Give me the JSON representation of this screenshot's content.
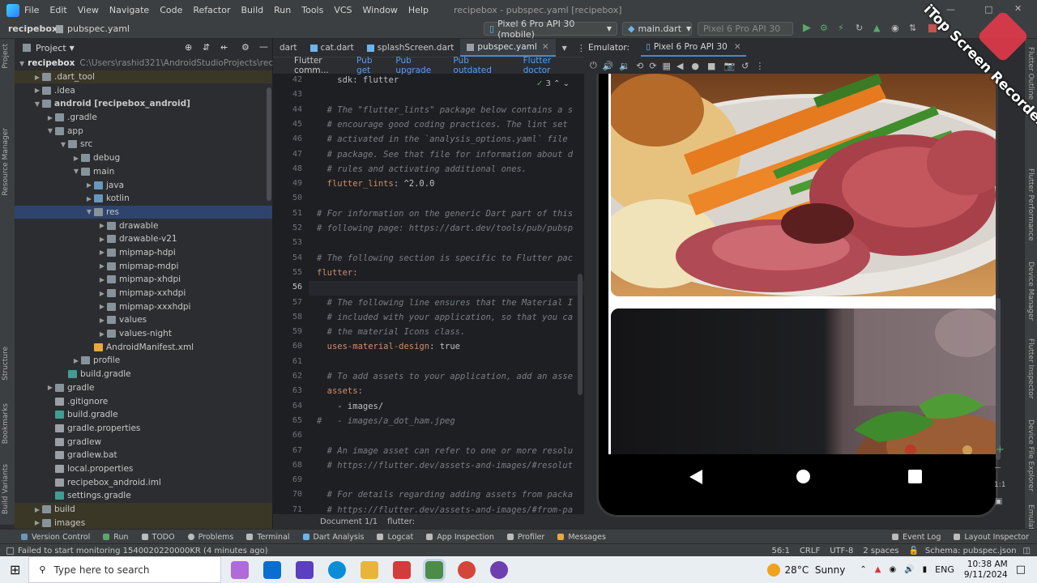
{
  "menubar": {
    "items": [
      "File",
      "Edit",
      "View",
      "Navigate",
      "Code",
      "Refactor",
      "Build",
      "Run",
      "Tools",
      "VCS",
      "Window",
      "Help"
    ],
    "title": "recipebox - pubspec.yaml [recipebox]"
  },
  "toolbar": {
    "breadcrumb_project": "recipebox",
    "breadcrumb_file": "pubspec.yaml",
    "device_select": "Pixel 6 Pro API 30 (mobile)",
    "run_config": "main.dart",
    "device_running": "Pixel 6 Pro API 30"
  },
  "left_strip": [
    "Project",
    "Resource Manager",
    "Structure",
    "Bookmarks",
    "Build Variants"
  ],
  "project": {
    "header": "Project",
    "root_label": "recipebox",
    "root_path": "C:\\Users\\rashid321\\AndroidStudioProjects\\recipebox",
    "rows": [
      {
        "label": ".dart_tool",
        "depth": 1
      },
      {
        "label": ".idea",
        "depth": 1
      },
      {
        "label": "android [recipebox_android]",
        "depth": 1
      },
      {
        "label": ".gradle",
        "depth": 2
      },
      {
        "label": "app",
        "depth": 2
      },
      {
        "label": "src",
        "depth": 3
      },
      {
        "label": "debug",
        "depth": 4
      },
      {
        "label": "main",
        "depth": 4
      },
      {
        "label": "java",
        "depth": 5
      },
      {
        "label": "kotlin",
        "depth": 5
      },
      {
        "label": "res",
        "depth": 5
      },
      {
        "label": "drawable",
        "depth": 6
      },
      {
        "label": "drawable-v21",
        "depth": 6
      },
      {
        "label": "mipmap-hdpi",
        "depth": 6
      },
      {
        "label": "mipmap-mdpi",
        "depth": 6
      },
      {
        "label": "mipmap-xhdpi",
        "depth": 6
      },
      {
        "label": "mipmap-xxhdpi",
        "depth": 6
      },
      {
        "label": "mipmap-xxxhdpi",
        "depth": 6
      },
      {
        "label": "values",
        "depth": 6
      },
      {
        "label": "values-night",
        "depth": 6
      },
      {
        "label": "AndroidManifest.xml",
        "depth": 5
      },
      {
        "label": "profile",
        "depth": 4
      },
      {
        "label": "build.gradle",
        "depth": 3
      },
      {
        "label": "gradle",
        "depth": 2
      },
      {
        "label": ".gitignore",
        "depth": 2
      },
      {
        "label": "build.gradle",
        "depth": 2
      },
      {
        "label": "gradle.properties",
        "depth": 2
      },
      {
        "label": "gradlew",
        "depth": 2
      },
      {
        "label": "gradlew.bat",
        "depth": 2
      },
      {
        "label": "local.properties",
        "depth": 2
      },
      {
        "label": "recipebox_android.iml",
        "depth": 2
      },
      {
        "label": "settings.gradle",
        "depth": 2
      },
      {
        "label": "build",
        "depth": 1
      },
      {
        "label": "images",
        "depth": 1
      }
    ]
  },
  "editor": {
    "tabs": [
      "dart",
      "cat.dart",
      "splashScreen.dart",
      "pubspec.yaml"
    ],
    "flutter_bar": {
      "label": "Flutter comm...",
      "links": [
        "Pub get",
        "Pub upgrade",
        "Pub outdated",
        "Flutter doctor"
      ]
    },
    "inspection_count": "3",
    "lines": [
      {
        "n": "42",
        "text": "    sdk: flutter",
        "kind": "val"
      },
      {
        "n": "43",
        "text": "",
        "kind": "val"
      },
      {
        "n": "44",
        "text": "  # The \"flutter_lints\" package below contains a s",
        "kind": "cmt"
      },
      {
        "n": "45",
        "text": "  # encourage good coding practices. The lint set",
        "kind": "cmt"
      },
      {
        "n": "46",
        "text": "  # activated in the `analysis_options.yaml` file",
        "kind": "cmt"
      },
      {
        "n": "47",
        "text": "  # package. See that file for information about d",
        "kind": "cmt"
      },
      {
        "n": "48",
        "text": "  # rules and activating additional ones.",
        "kind": "cmt"
      },
      {
        "n": "49",
        "text": "  flutter_lints: ^2.0.0",
        "kind": "kv"
      },
      {
        "n": "50",
        "text": "",
        "kind": "val"
      },
      {
        "n": "51",
        "text": "# For information on the generic Dart part of this",
        "kind": "cmt"
      },
      {
        "n": "52",
        "text": "# following page: https://dart.dev/tools/pub/pubsp",
        "kind": "cmt"
      },
      {
        "n": "53",
        "text": "",
        "kind": "val"
      },
      {
        "n": "54",
        "text": "# The following section is specific to Flutter pac",
        "kind": "cmt"
      },
      {
        "n": "55",
        "text": "flutter:",
        "kind": "key"
      },
      {
        "n": "56",
        "text": "",
        "kind": "val"
      },
      {
        "n": "57",
        "text": "  # The following line ensures that the Material I",
        "kind": "cmt"
      },
      {
        "n": "58",
        "text": "  # included with your application, so that you ca",
        "kind": "cmt"
      },
      {
        "n": "59",
        "text": "  # the material Icons class.",
        "kind": "cmt"
      },
      {
        "n": "60",
        "text": "  uses-material-design: true",
        "kind": "kv"
      },
      {
        "n": "61",
        "text": "",
        "kind": "val"
      },
      {
        "n": "62",
        "text": "  # To add assets to your application, add an asse",
        "kind": "cmt"
      },
      {
        "n": "63",
        "text": "  assets:",
        "kind": "key"
      },
      {
        "n": "64",
        "text": "    - images/",
        "kind": "val"
      },
      {
        "n": "65",
        "text": "#   - images/a_dot_ham.jpeg",
        "kind": "cmt"
      },
      {
        "n": "66",
        "text": "",
        "kind": "val"
      },
      {
        "n": "67",
        "text": "  # An image asset can refer to one or more resolu",
        "kind": "cmt"
      },
      {
        "n": "68",
        "text": "  # https://flutter.dev/assets-and-images/#resolut",
        "kind": "cmt"
      },
      {
        "n": "69",
        "text": "",
        "kind": "val"
      },
      {
        "n": "70",
        "text": "  # For details regarding adding assets from packa",
        "kind": "cmt"
      },
      {
        "n": "71",
        "text": "  # https://flutter.dev/assets-and-images/#from-pa",
        "kind": "cmt"
      }
    ],
    "status_doc": "Document 1/1",
    "status_path": "flutter:"
  },
  "emulator": {
    "label": "Emulator:",
    "device_tab": "Pixel 6 Pro API 30",
    "zoom": "1:1"
  },
  "right_strip": [
    "Flutter Outline",
    "Flutter Performance",
    "Device Manager",
    "Flutter Inspector",
    "Device File Explorer",
    "Emulator"
  ],
  "bottom_tools": [
    "Version Control",
    "Run",
    "TODO",
    "Problems",
    "Terminal",
    "Dart Analysis",
    "Logcat",
    "App Inspection",
    "Profiler",
    "Messages",
    "Event Log",
    "Layout Inspector"
  ],
  "status": {
    "message": "Failed to start monitoring 1540020220000KR (4 minutes ago)",
    "position": "56:1",
    "line_sep": "CRLF",
    "encoding": "UTF-8",
    "indent": "2 spaces",
    "schema": "Schema: pubspec.json"
  },
  "taskbar": {
    "search_placeholder": "Type here to search",
    "weather": "28°C  Sunny",
    "lang": "ENG",
    "time": "10:38 AM",
    "date": "9/11/2024"
  },
  "watermark": "iTop Screen Recorder",
  "colors": {
    "accent": "#4a88c7",
    "selection": "#2e436e",
    "link": "#589df6"
  }
}
